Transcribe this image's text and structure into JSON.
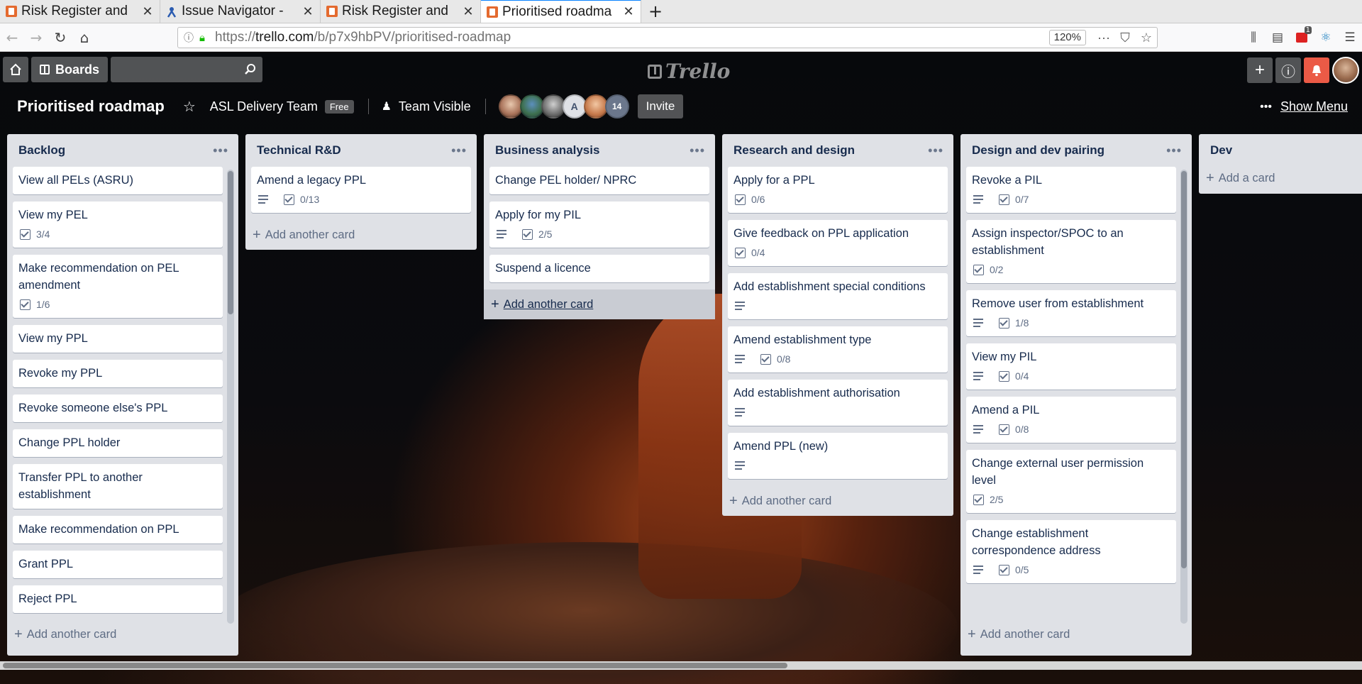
{
  "browser": {
    "tabs": [
      {
        "title": "Risk Register and",
        "icon": "trello-favicon",
        "active": false
      },
      {
        "title": "Issue Navigator -",
        "icon": "jira-favicon",
        "active": false
      },
      {
        "title": "Risk Register and",
        "icon": "trello-favicon",
        "active": false
      },
      {
        "title": "Prioritised roadma",
        "icon": "trello-favicon",
        "active": true
      }
    ],
    "url_prefix": "https://",
    "url_host": "trello.com",
    "url_path": "/b/p7x9hbPV/prioritised-roadmap",
    "zoom": "120%",
    "notification_count": "1"
  },
  "header": {
    "boards_label": "Boards",
    "logo_text": "Trello"
  },
  "board": {
    "title": "Prioritised roadmap",
    "team": "ASL Delivery Team",
    "plan_badge": "Free",
    "visibility": "Team Visible",
    "members": [
      {
        "initial": ""
      },
      {
        "initial": ""
      },
      {
        "initial": ""
      },
      {
        "initial": "A"
      },
      {
        "initial": ""
      }
    ],
    "member_more_count": "14",
    "invite_label": "Invite",
    "show_menu_label": "Show Menu"
  },
  "lists": [
    {
      "title": "Backlog",
      "add_label": "Add another card",
      "cards": [
        {
          "title": "View all PELs (ASRU)"
        },
        {
          "title": "View my PEL",
          "checklist": "3/4"
        },
        {
          "title": "Make recommendation on PEL amendment",
          "checklist": "1/6"
        },
        {
          "title": "View my PPL"
        },
        {
          "title": "Revoke my PPL"
        },
        {
          "title": "Revoke someone else's PPL"
        },
        {
          "title": "Change PPL holder"
        },
        {
          "title": "Transfer PPL to another establishment"
        },
        {
          "title": "Make recommendation on PPL"
        },
        {
          "title": "Grant PPL"
        },
        {
          "title": "Reject PPL"
        }
      ]
    },
    {
      "title": "Technical R&D",
      "add_label": "Add another card",
      "cards": [
        {
          "title": "Amend a legacy PPL",
          "description": true,
          "checklist": "0/13"
        }
      ]
    },
    {
      "title": "Business analysis",
      "add_label": "Add another card",
      "cards": [
        {
          "title": "Change PEL holder/ NPRC"
        },
        {
          "title": "Apply for my PIL",
          "description": true,
          "checklist": "2/5"
        },
        {
          "title": "Suspend a licence"
        }
      ]
    },
    {
      "title": "Research and design",
      "add_label": "Add another card",
      "cards": [
        {
          "title": "Apply for a PPL",
          "checklist": "0/6"
        },
        {
          "title": "Give feedback on PPL application",
          "checklist": "0/4"
        },
        {
          "title": "Add establishment special conditions",
          "description": true
        },
        {
          "title": "Amend establishment type",
          "description": true,
          "checklist": "0/8"
        },
        {
          "title": "Add establishment authorisation",
          "description": true
        },
        {
          "title": "Amend PPL (new)",
          "description": true
        }
      ]
    },
    {
      "title": "Design and dev pairing",
      "add_label": "Add another card",
      "cards": [
        {
          "title": "Revoke a PIL",
          "description": true,
          "checklist": "0/7"
        },
        {
          "title": "Assign inspector/SPOC to an establishment",
          "checklist": "0/2"
        },
        {
          "title": "Remove user from establishment",
          "description": true,
          "checklist": "1/8"
        },
        {
          "title": "View my PIL",
          "description": true,
          "checklist": "0/4"
        },
        {
          "title": "Amend a PIL",
          "description": true,
          "checklist": "0/8"
        },
        {
          "title": "Change external user permission level",
          "checklist": "2/5"
        },
        {
          "title": "Change establishment correspondence address",
          "description": true,
          "checklist": "0/5"
        }
      ]
    },
    {
      "title": "Dev",
      "add_label": "Add a card",
      "cards": []
    }
  ]
}
